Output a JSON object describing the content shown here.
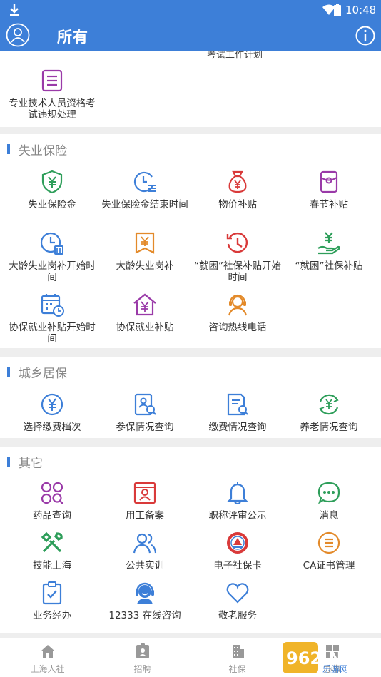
{
  "status": {
    "time": "10:48"
  },
  "appbar": {
    "title": "所有"
  },
  "top_section": {
    "clipped_text": "考试工作计划",
    "items": [
      {
        "label": "专业技术人员资格考试违规处理",
        "icon": "document-list-icon"
      }
    ]
  },
  "sections": [
    {
      "title": "失业保险",
      "items": [
        {
          "label": "失业保险金",
          "icon": "yuan-shield-icon"
        },
        {
          "label": "失业保险金结束时间",
          "icon": "clock-list-icon"
        },
        {
          "label": "物价补贴",
          "icon": "money-bag-icon"
        },
        {
          "label": "春节补贴",
          "icon": "red-packet-icon"
        },
        {
          "label": "大龄失业岗补开始时间",
          "icon": "clock-calendar-icon"
        },
        {
          "label": "大龄失业岗补",
          "icon": "yuan-card-icon"
        },
        {
          "label": "“就困”社保补贴开始时间",
          "icon": "history-clock-icon"
        },
        {
          "label": "“就困”社保补贴",
          "icon": "yuan-hand-icon"
        },
        {
          "label": "协保就业补贴开始时间",
          "icon": "calendar-clock-icon"
        },
        {
          "label": "协保就业补贴",
          "icon": "yuan-house-icon"
        },
        {
          "label": "咨询热线电话",
          "icon": "headset-person-icon"
        }
      ]
    },
    {
      "title": "城乡居保",
      "items": [
        {
          "label": "选择缴费档次",
          "icon": "yuan-circle-icon"
        },
        {
          "label": "参保情况查询",
          "icon": "person-search-icon"
        },
        {
          "label": "缴费情况查询",
          "icon": "document-search-icon"
        },
        {
          "label": "养老情况查询",
          "icon": "yuan-cycle-icon"
        }
      ]
    },
    {
      "title": "其它",
      "items": [
        {
          "label": "药品查询",
          "icon": "pills-search-icon"
        },
        {
          "label": "用工备案",
          "icon": "id-card-icon"
        },
        {
          "label": "职称评审公示",
          "icon": "bell-icon"
        },
        {
          "label": "消息",
          "icon": "chat-bubble-icon"
        },
        {
          "label": "技能上海",
          "icon": "tools-icon"
        },
        {
          "label": "公共实训",
          "icon": "people-icon"
        },
        {
          "label": "电子社保卡",
          "icon": "emblem-icon"
        },
        {
          "label": "CA证书管理",
          "icon": "list-circle-icon"
        },
        {
          "label": "业务经办",
          "icon": "clipboard-check-icon"
        },
        {
          "label": "12333 在线咨询",
          "icon": "customer-service-icon"
        },
        {
          "label": "敬老服务",
          "icon": "heart-icon"
        }
      ]
    }
  ],
  "tabs": [
    {
      "label": "上海人社",
      "icon": "home-icon"
    },
    {
      "label": "招聘",
      "icon": "badge-icon"
    },
    {
      "label": "社保",
      "icon": "building-icon"
    },
    {
      "label": "办事",
      "icon": "grid-icon"
    }
  ],
  "watermark": {
    "text": "962.NET",
    "sub": "乐游网"
  },
  "colors": {
    "primary": "#3d7fd8",
    "green": "#2e9e5a",
    "red": "#d93a3a",
    "purple": "#9a3aa8",
    "orange": "#e38a2a",
    "blue": "#3d7fd8"
  }
}
